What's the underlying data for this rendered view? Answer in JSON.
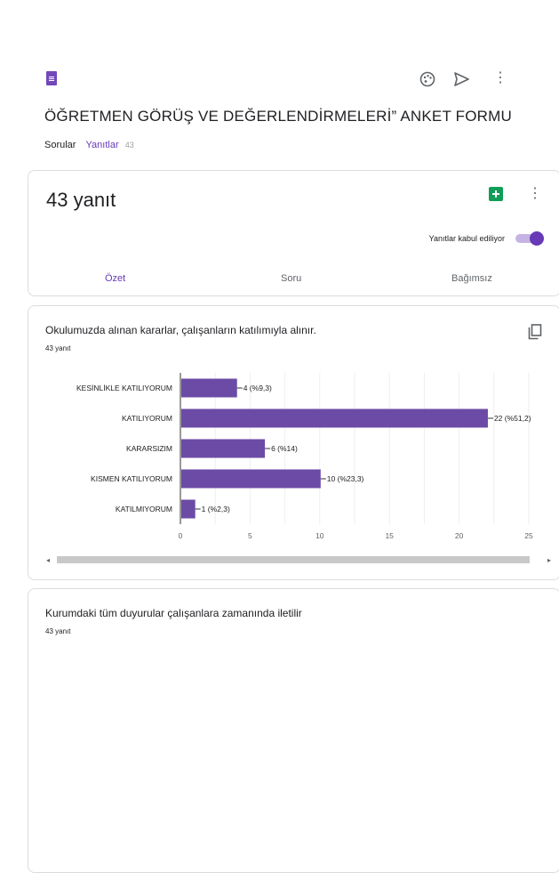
{
  "app": {
    "title": "ÖĞRETMEN GÖRÜŞ VE DEĞERLENDİRMELERİ” ANKET FORMU",
    "tabs": [
      {
        "label": "Sorular",
        "active": false
      },
      {
        "label": "Yanıtlar",
        "active": true,
        "count": "43"
      }
    ],
    "icons": [
      "form-icon",
      "palette-icon",
      "send-icon",
      "more-vert-icon"
    ]
  },
  "summary": {
    "count_label": "43 yanıt",
    "accepting_label": "Yanıtlar kabul ediliyor",
    "accepting": true,
    "subtabs": [
      "Özet",
      "Soru",
      "Bağımsız"
    ],
    "active_subtab": "Özet"
  },
  "questions": [
    {
      "title": "Okulumuzda alınan kararlar, çalışanların katılımıyla alınır.",
      "subtitle": "43 yanıt",
      "chart_data": {
        "type": "bar",
        "orientation": "horizontal",
        "categories": [
          "KESİNLİKLE KATILIYORUM",
          "KATILIYORUM",
          "KARARSIZIM",
          "KISMEN KATILIYORUM",
          "KATILMIYORUM"
        ],
        "values": [
          4,
          22,
          6,
          10,
          1
        ],
        "data_labels": [
          "4 (%9,3)",
          "22 (%51,2)",
          "6 (%14)",
          "10 (%23,3)",
          "1 (%2,3)"
        ],
        "xlim": [
          0,
          25
        ],
        "xticks": [
          0,
          5,
          10,
          15,
          20,
          25
        ],
        "grid": true,
        "bar_color": "#6c4ba6"
      }
    },
    {
      "title": "Kurumdaki tüm duyurular çalışanlara zamanında iletilir",
      "subtitle": "43 yanıt"
    }
  ],
  "colors": {
    "accent": "#673ab7",
    "bar": "#6c4ba6",
    "sheets": "#0f9d58"
  }
}
